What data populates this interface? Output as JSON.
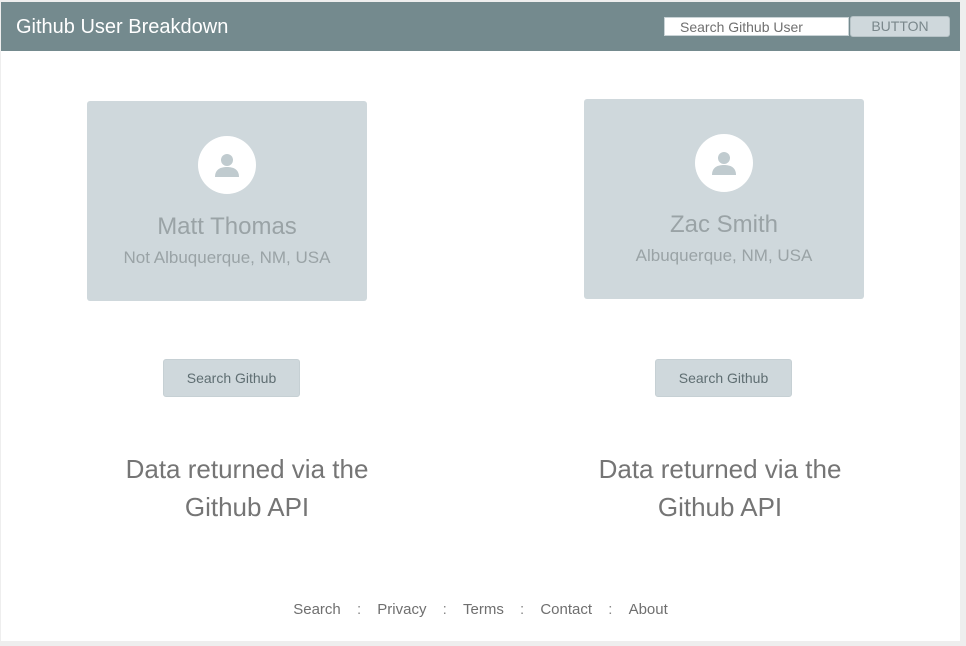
{
  "header": {
    "title": "Github User Breakdown",
    "search_placeholder": "Search Github User",
    "button_label": "BUTTON"
  },
  "cards": [
    {
      "name": "Matt Thomas",
      "location": "Not Albuquerque, NM, USA",
      "button_label": "Search Github",
      "data_text_line1": "Data returned via the",
      "data_text_line2": "Github API"
    },
    {
      "name": "Zac Smith",
      "location": "Albuquerque, NM, USA",
      "button_label": "Search Github",
      "data_text_line1": "Data returned via the",
      "data_text_line2": "Github API"
    }
  ],
  "footer": {
    "links": [
      "Search",
      "Privacy",
      "Terms",
      "Contact",
      "About"
    ],
    "separator": ":"
  },
  "colors": {
    "header_bg": "#748a8e",
    "card_bg": "#cfd8dc"
  },
  "icons": {
    "avatar": "account-person-icon"
  }
}
